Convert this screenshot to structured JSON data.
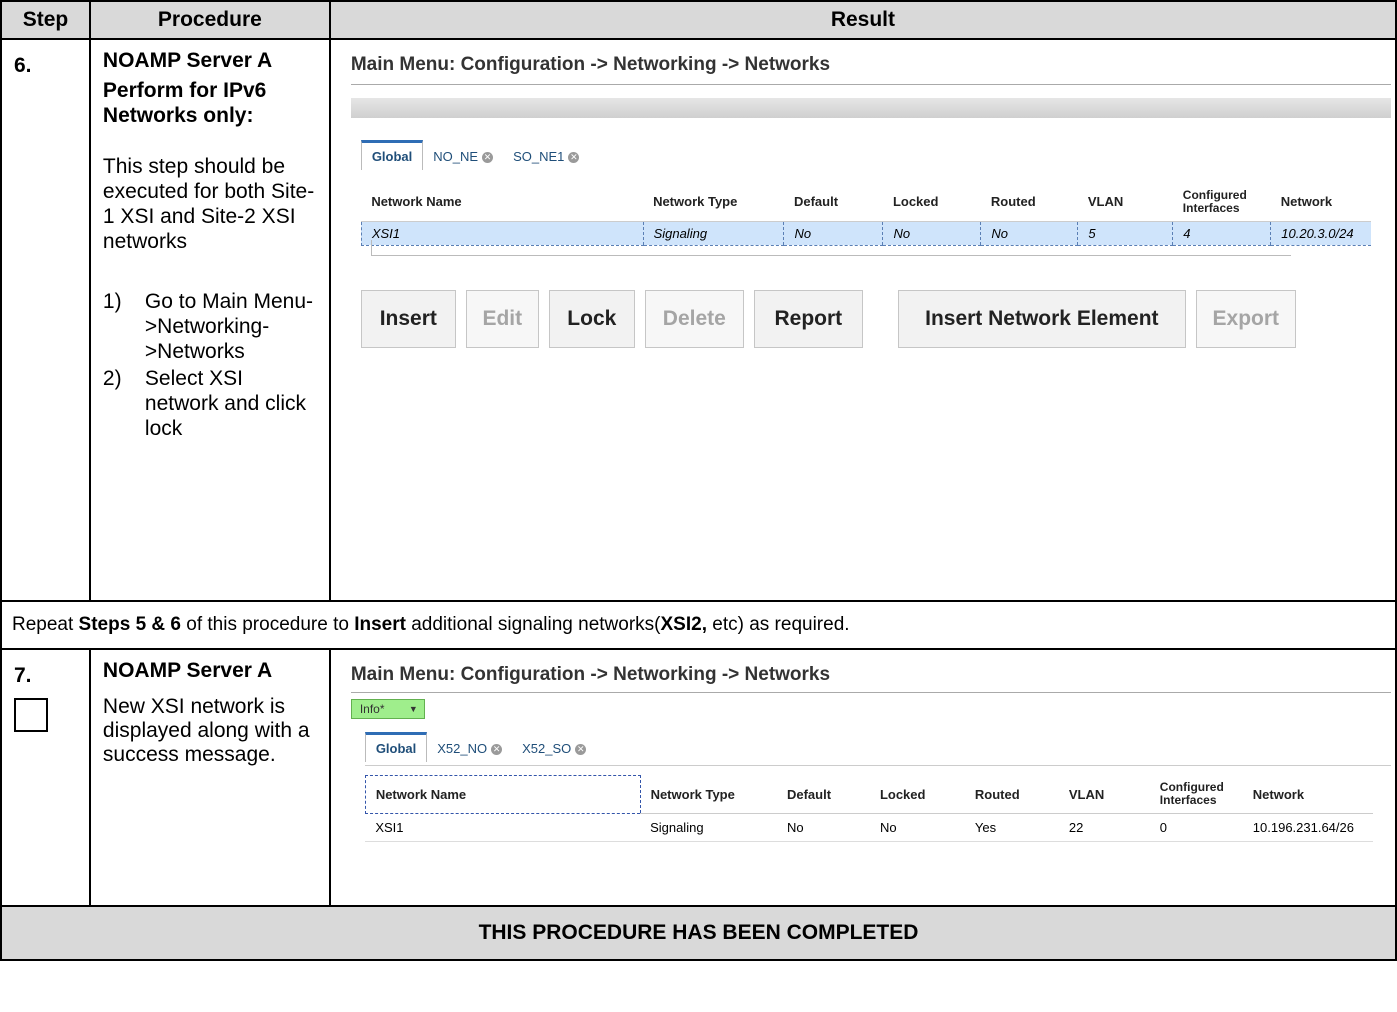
{
  "header": {
    "step": "Step",
    "procedure": "Procedure",
    "result": "Result"
  },
  "step6": {
    "number": "6.",
    "title_line1": "NOAMP Server A",
    "title_line2": "Perform for IPv6 Networks only:",
    "note": "This step should be executed for both Site-1 XSI and Site-2 XSI networks",
    "items": [
      {
        "num": "1)",
        "text": "Go to Main Menu->Networking->Networks"
      },
      {
        "num": "2)",
        "text": "Select XSI network and click lock"
      }
    ],
    "screen": {
      "title": "Main Menu: Configuration -> Networking -> Networks",
      "tabs": [
        "Global",
        "NO_NE",
        "SO_NE1"
      ],
      "columns": [
        "Network Name",
        "Network Type",
        "Default",
        "Locked",
        "Routed",
        "VLAN",
        "Configured Interfaces",
        "Network"
      ],
      "row": [
        "XSI1",
        "Signaling",
        "No",
        "No",
        "No",
        "5",
        "4",
        "10.20.3.0/24"
      ],
      "buttons": {
        "insert": "Insert",
        "edit": "Edit",
        "lock": "Lock",
        "delete": "Delete",
        "report": "Report",
        "insert_ne": "Insert Network Element",
        "export": "Export"
      }
    }
  },
  "repeat": {
    "t1": "Repeat ",
    "b1": "Steps 5 & 6",
    "t2": " of this procedure to ",
    "b2": "Insert",
    "t3": " additional signaling networks(",
    "b3": "XSI2,",
    "t4": " etc) as required."
  },
  "step7": {
    "number": "7.",
    "title": "NOAMP Server A",
    "text": "New XSI network is displayed along with a success message.",
    "screen": {
      "title": "Main Menu: Configuration -> Networking -> Networks",
      "info": "Info*",
      "tabs": [
        "Global",
        "X52_NO",
        "X52_SO"
      ],
      "columns": [
        "Network Name",
        "Network Type",
        "Default",
        "Locked",
        "Routed",
        "VLAN",
        "Configured Interfaces",
        "Network"
      ],
      "row": [
        "XSI1",
        "Signaling",
        "No",
        "No",
        "Yes",
        "22",
        "0",
        "10.196.231.64/26"
      ]
    }
  },
  "footer": "THIS PROCEDURE HAS BEEN COMPLETED"
}
